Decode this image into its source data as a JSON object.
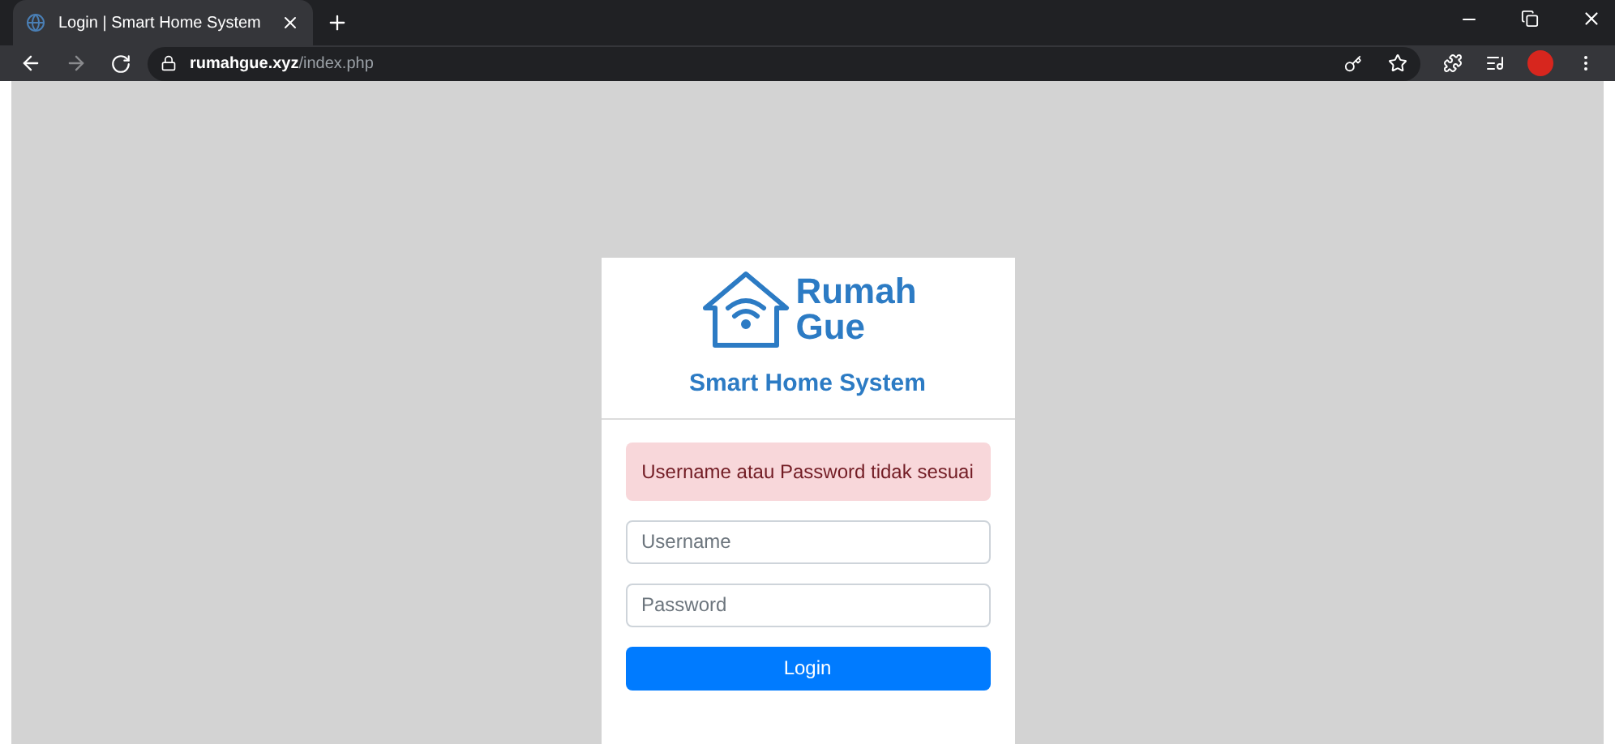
{
  "browser": {
    "tab": {
      "title": "Login | Smart Home System",
      "selected": true
    },
    "url_host": "rumahgue.xyz",
    "url_path": "/index.php"
  },
  "card": {
    "brand_line_1": "Rumah",
    "brand_line_2": "Gue",
    "subtitle": "Smart Home System",
    "alert": "Username atau Password tidak sesuai",
    "username": {
      "placeholder": "Username"
    },
    "password": {
      "placeholder": "Password"
    },
    "button": "Login"
  }
}
